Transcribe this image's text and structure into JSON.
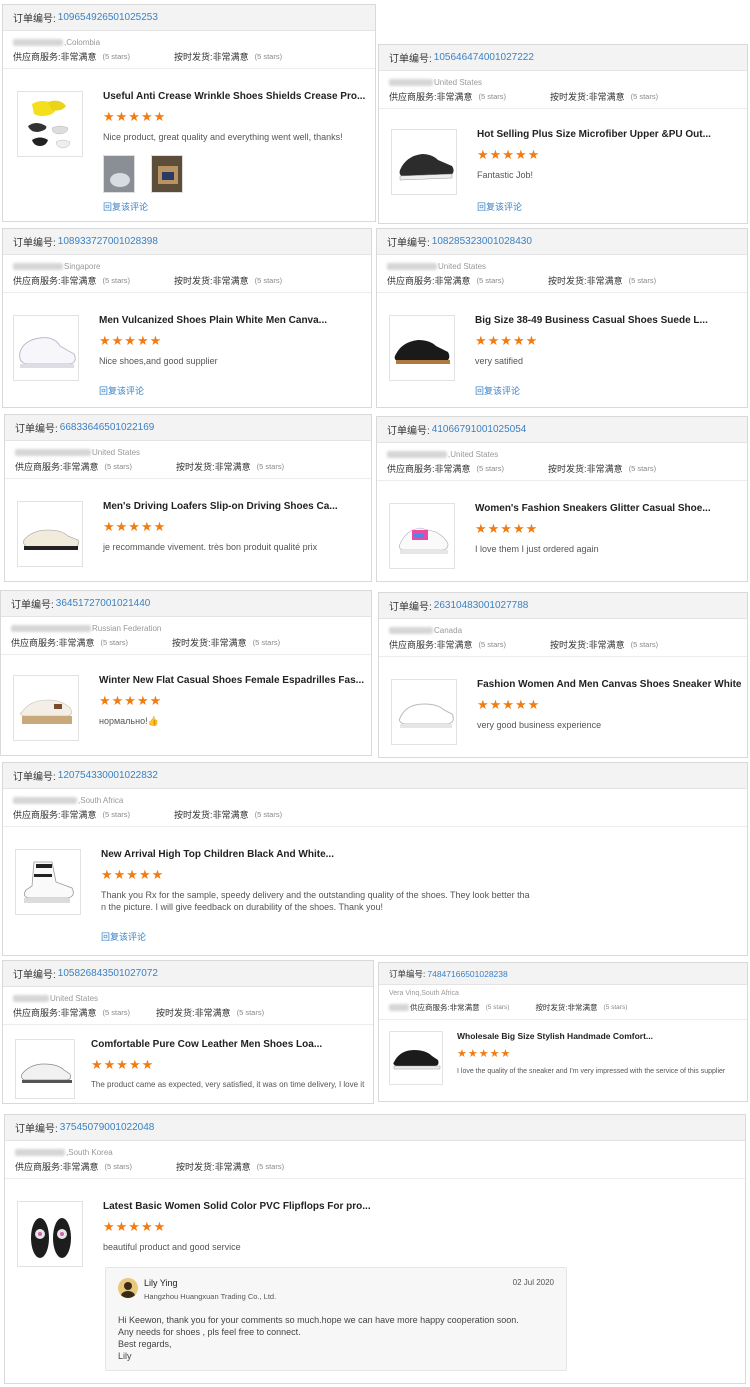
{
  "labels": {
    "order_prefix": "订单编号:",
    "supplier_service": "供应商服务:",
    "on_time": "按时发货:",
    "very_satisfied": "非常满意",
    "five_stars": "(5 stars)",
    "reply_review": "回复该评论",
    "stars": "★★★★★"
  },
  "reviews": [
    {
      "order": "109654926501025253",
      "country": "Colombia",
      "title": "Useful Anti Crease Wrinkle Shoes Shields Crease Pro...",
      "comment": "Nice product, great quality and everything went well, thanks!",
      "has_reply_link": true
    },
    {
      "order": "105646474001027222",
      "country": "United States",
      "title": "Hot Selling Plus Size Microfiber Upper &PU Out...",
      "comment": "Fantastic Job!",
      "has_reply_link": true
    },
    {
      "order": "108933727001028398",
      "country": "Singapore",
      "title": "Men Vulcanized Shoes Plain White Men Canva...",
      "comment": "Nice shoes,and good supplier",
      "has_reply_link": true
    },
    {
      "order": "108285323001028430",
      "country": "United States",
      "title": "Big Size 38-49 Business Casual Shoes Suede L...",
      "comment": "very satified",
      "has_reply_link": true
    },
    {
      "order": "66833646501022169",
      "country": "United States",
      "title": "Men's Driving Loafers Slip-on Driving Shoes Ca...",
      "comment": "je recommande vivement. très bon produit qualité prix"
    },
    {
      "order": "41066791001025054",
      "country": "United States",
      "title": "Women's Fashion Sneakers Glitter Casual Shoe...",
      "comment": "I love them I just ordered again"
    },
    {
      "order": "36451727001021440",
      "country": "Russian Federation",
      "title": "Winter New Flat Casual Shoes Female Espadrilles Fas...",
      "comment": "нормально!👍"
    },
    {
      "order": "26310483001027788",
      "country": "Canada",
      "title": "Fashion Women And Men Canvas Shoes Sneaker White",
      "comment": "very good business experience"
    },
    {
      "order": "120754330001022832",
      "country": "South Africa",
      "title": "New Arrival High Top Children Black And White...",
      "comment_lines": [
        "Thank you Rx for the sample, speedy delivery and the outstanding quality of the shoes. They look better tha",
        "n the picture. I will give feedback on durability of the shoes. Thank you!"
      ],
      "has_reply_link": true
    },
    {
      "order": "105826843501027072",
      "country": "United States",
      "title": "Comfortable Pure Cow Leather Men Shoes Loa...",
      "comment": "The product came as expected, very satisfied, it was on time delivery, I love it"
    },
    {
      "order": "74847166501028238",
      "country": "South Africa",
      "buyer": "Vera Vinq",
      "title": "Wholesale Big Size Stylish Handmade Comfort...",
      "comment": "I love the quality of the sneaker and I'm very impressed with the service of this supplier"
    },
    {
      "order": "37545079001022048",
      "country": "South Korea",
      "title": "Latest Basic Women Solid Color PVC Flipflops For pro...",
      "comment": "beautiful product and good service"
    }
  ],
  "supplier_reply": {
    "name": "Lily Ying",
    "company": "Hangzhou Huangxuan Trading Co., Ltd.",
    "date": "02 Jul 2020",
    "lines": [
      "Hi Keewon, thank you for your comments so much.hope we can have more happy cooperation soon.",
      "Any needs for shoes , pls feel free to connect.",
      "Best regards,",
      "Lily"
    ]
  },
  "colors": {
    "accent": "#3a82c4",
    "star": "#f07c13",
    "header_bg": "#f3f3f3"
  }
}
